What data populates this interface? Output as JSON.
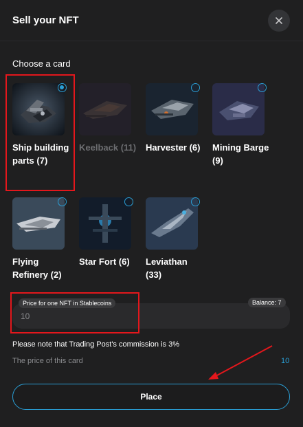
{
  "modal": {
    "title": "Sell your NFT",
    "section_label": "Choose a card"
  },
  "cards": [
    {
      "name": "Ship building parts (7)",
      "selected": true,
      "disabled": false,
      "icon": "ship-parts"
    },
    {
      "name": "Keelback (11)",
      "selected": false,
      "disabled": true,
      "icon": "keelback-ship"
    },
    {
      "name": "Harvester (6)",
      "selected": false,
      "disabled": false,
      "icon": "harvester-ship"
    },
    {
      "name": "Mining Barge (9)",
      "selected": false,
      "disabled": false,
      "icon": "mining-barge-ship"
    },
    {
      "name": "Flying Refinery (2)",
      "selected": false,
      "disabled": false,
      "icon": "flying-refinery-ship"
    },
    {
      "name": "Star Fort (6)",
      "selected": false,
      "disabled": false,
      "icon": "star-fort"
    },
    {
      "name": "Leviathan (33)",
      "selected": false,
      "disabled": false,
      "icon": "leviathan-ship"
    }
  ],
  "price": {
    "label": "Price for one NFT in Stablecoins",
    "balance": "Balance: 7",
    "placeholder": "10"
  },
  "note": "Please note that Trading Post's commission is 3%",
  "card_price": {
    "label": "The price of this card",
    "value": "10"
  },
  "place_button": "Place",
  "colors": {
    "accent": "#2a9fd6",
    "highlight": "#e4171c",
    "background": "#1f1f20"
  }
}
